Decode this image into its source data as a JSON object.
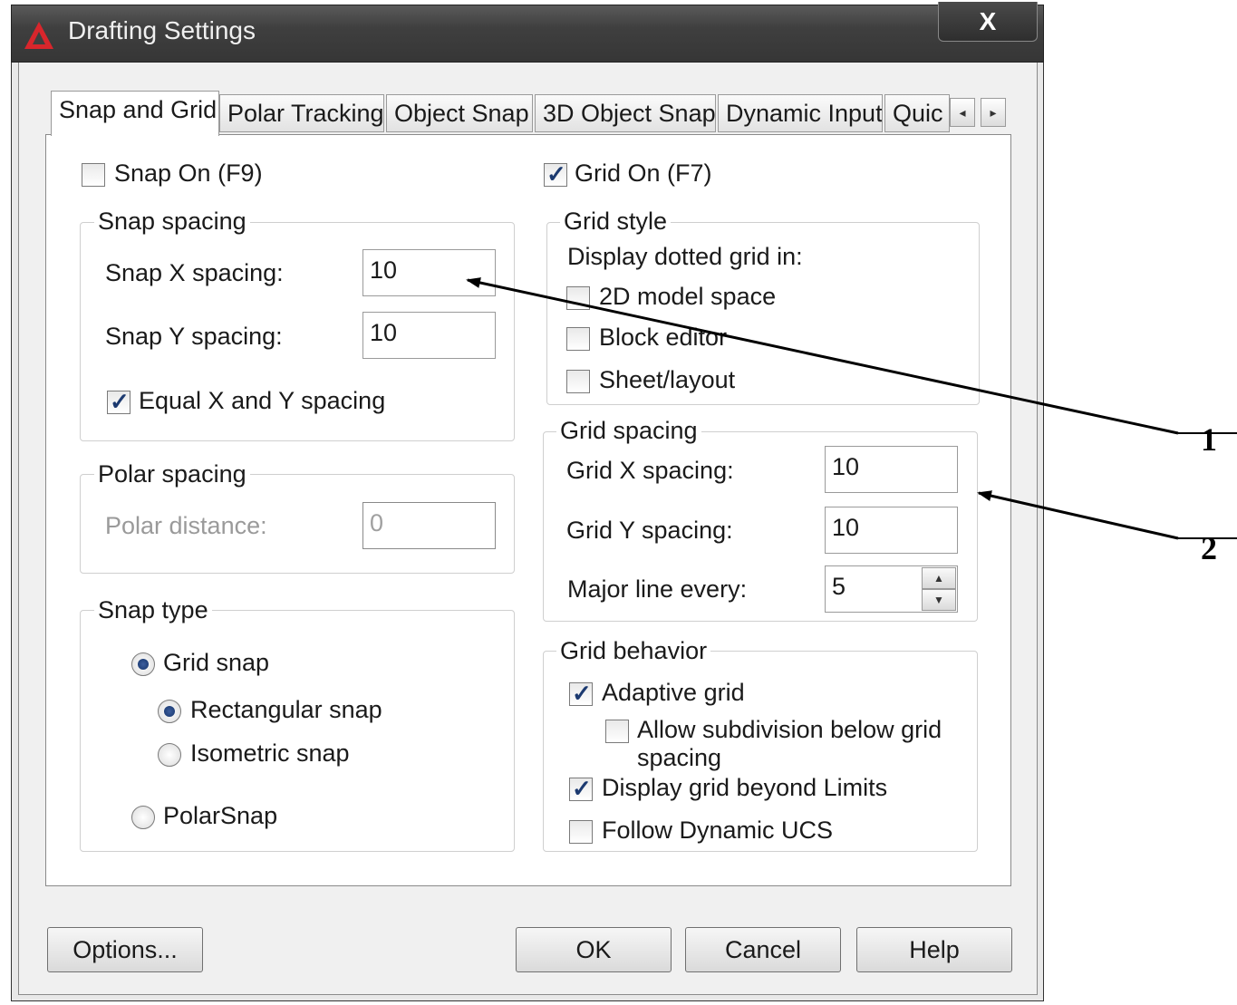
{
  "window": {
    "title": "Drafting Settings",
    "close_label": "X"
  },
  "tabs": [
    "Snap and Grid",
    "Polar Tracking",
    "Object Snap",
    "3D Object Snap",
    "Dynamic Input",
    "Quic"
  ],
  "tab_scroll": {
    "left": "◂",
    "right": "▸"
  },
  "snap_on": {
    "label": "Snap On (F9)",
    "checked": false
  },
  "grid_on": {
    "label": "Grid On (F7)",
    "checked": true
  },
  "snap_spacing": {
    "title": "Snap spacing",
    "x_label": "Snap X spacing:",
    "x_value": "10",
    "y_label": "Snap Y spacing:",
    "y_value": "10",
    "equal_label": "Equal X and Y spacing",
    "equal_checked": true
  },
  "polar_spacing": {
    "title": "Polar spacing",
    "distance_label": "Polar distance:",
    "distance_value": "0"
  },
  "snap_type": {
    "title": "Snap type",
    "grid_snap": "Grid snap",
    "rectangular": "Rectangular snap",
    "isometric": "Isometric snap",
    "polar": "PolarSnap"
  },
  "grid_style": {
    "title": "Grid style",
    "display_label": "Display dotted grid in:",
    "model_space": "2D model space",
    "block_editor": "Block editor",
    "sheet_layout": "Sheet/layout"
  },
  "grid_spacing": {
    "title": "Grid spacing",
    "x_label": "Grid X spacing:",
    "x_value": "10",
    "y_label": "Grid Y spacing:",
    "y_value": "10",
    "major_label": "Major line every:",
    "major_value": "5"
  },
  "grid_behavior": {
    "title": "Grid behavior",
    "adaptive": "Adaptive grid",
    "subdivision_line1": "Allow subdivision below grid",
    "subdivision_line2": "spacing",
    "beyond_limits": "Display grid beyond Limits",
    "follow_ucs": "Follow Dynamic UCS"
  },
  "buttons": {
    "options": "Options...",
    "ok": "OK",
    "cancel": "Cancel",
    "help": "Help"
  },
  "callouts": [
    "1",
    "2"
  ]
}
